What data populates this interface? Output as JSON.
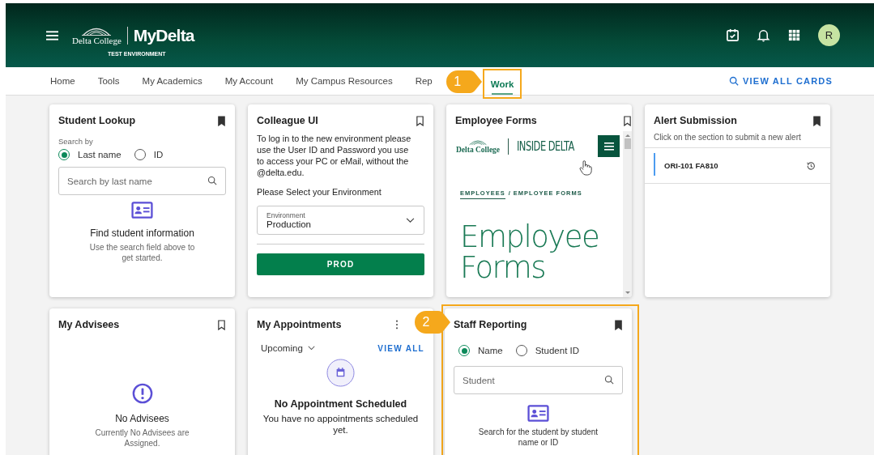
{
  "header": {
    "brand": "Delta College",
    "subtitle": "TEST ENVIRONMENT",
    "app": "MyDelta",
    "avatar": "R"
  },
  "nav": {
    "tabs": [
      {
        "label": "Home",
        "selected": false
      },
      {
        "label": "Tools",
        "selected": false
      },
      {
        "label": "My Academics",
        "selected": false
      },
      {
        "label": "My Account",
        "selected": false
      },
      {
        "label": "My Campus Resources",
        "selected": false
      },
      {
        "label": "Rep",
        "selected": false
      },
      {
        "label": "Work",
        "selected": true,
        "callout": "1"
      }
    ],
    "view_all": "VIEW ALL CARDS"
  },
  "cards": [
    {
      "kind": "lookup",
      "title": "Student Lookup",
      "bookmarked": true,
      "search_by": "Search by",
      "options": [
        {
          "label": "Last name",
          "selected": true
        },
        {
          "label": "ID",
          "selected": false
        }
      ],
      "placeholder": "Search by last name",
      "empty_title": "Find student information",
      "empty_text": "Use the search field above to get started."
    },
    {
      "kind": "colleague",
      "title": "Colleague UI",
      "bookmarked": false,
      "text": "To log in to the new environment please use the User ID and Password you use to access your PC or eMail, without the @delta.edu.",
      "prompt": "Please Select your Environment",
      "select": {
        "label": "Environment",
        "value": "Production"
      },
      "button": "PROD"
    },
    {
      "kind": "embed",
      "title": "Employee Forms",
      "bookmarked": false,
      "brand": "Delta College",
      "site": "INSIDE DELTA",
      "breadcrumb": [
        "EMPLOYEES",
        "/ EMPLOYEE FORMS"
      ],
      "heading": "Employee Forms"
    },
    {
      "kind": "alerts",
      "title": "Alert Submission",
      "bookmarked": true,
      "hint": "Click on the section to submit a new alert",
      "items": [
        {
          "label": "ORI-101 FA810"
        }
      ]
    },
    {
      "kind": "advisees",
      "title": "My Advisees",
      "bookmarked": false,
      "empty_title": "No Advisees",
      "empty_text": "Currently No Advisees are Assigned."
    },
    {
      "kind": "appointments",
      "title": "My Appointments",
      "filter": "Upcoming",
      "link": "VIEW ALL",
      "empty_title": "No Appointment Scheduled",
      "empty_text": "You have no appointments scheduled yet."
    },
    {
      "kind": "staff",
      "title": "Staff Reporting",
      "bookmarked": true,
      "callout": "2",
      "options": [
        {
          "label": "Name",
          "selected": true
        },
        {
          "label": "Student ID",
          "selected": false
        }
      ],
      "placeholder": "Student",
      "empty_text": "Search for the student by student name or ID"
    }
  ]
}
